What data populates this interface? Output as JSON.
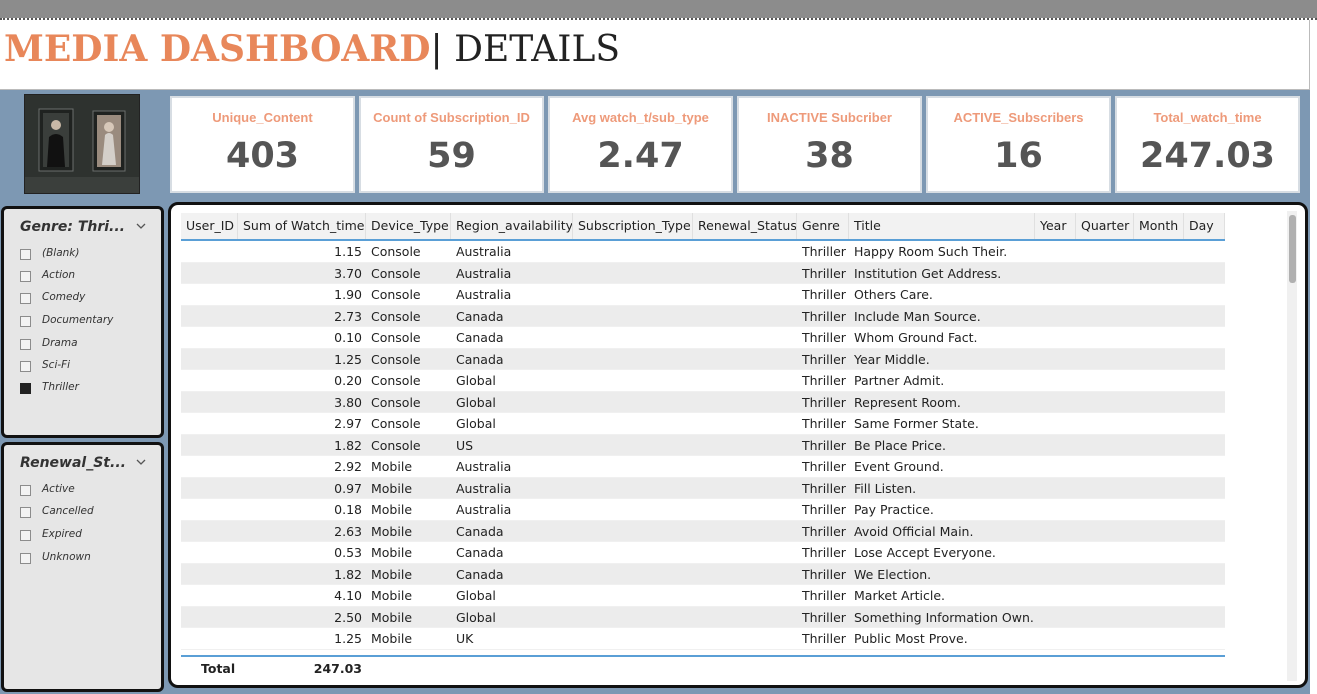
{
  "header": {
    "title_main": "MEDIA DASHBOARD",
    "separator": "|",
    "title_sub": " DETAILS"
  },
  "kpis": [
    {
      "label": "Unique_Content",
      "value": "403"
    },
    {
      "label": "Count of Subscription_ID",
      "value": "59"
    },
    {
      "label": "Avg watch_t/sub_type",
      "value": "2.47"
    },
    {
      "label": "INACTIVE Subcriber",
      "value": "38"
    },
    {
      "label": "ACTIVE_Subscribers",
      "value": "16"
    },
    {
      "label": "Total_watch_time",
      "value": "247.03"
    }
  ],
  "genre_slicer": {
    "title": "Genre: Thri...",
    "options": [
      {
        "label": "(Blank)",
        "checked": false
      },
      {
        "label": "Action",
        "checked": false
      },
      {
        "label": "Comedy",
        "checked": false
      },
      {
        "label": "Documentary",
        "checked": false
      },
      {
        "label": "Drama",
        "checked": false
      },
      {
        "label": "Sci-Fi",
        "checked": false
      },
      {
        "label": "Thriller",
        "checked": true
      }
    ]
  },
  "renewal_slicer": {
    "title": "Renewal_St...",
    "options": [
      {
        "label": "Active",
        "checked": false
      },
      {
        "label": "Cancelled",
        "checked": false
      },
      {
        "label": "Expired",
        "checked": false
      },
      {
        "label": "Unknown",
        "checked": false
      }
    ]
  },
  "table": {
    "columns": [
      "User_ID",
      "Sum of Watch_time",
      "Device_Type",
      "Region_availability",
      "Subscription_Type",
      "Renewal_Status",
      "Genre",
      "Title",
      "Year",
      "Quarter",
      "Month",
      "Day"
    ],
    "rows": [
      [
        "",
        "1.15",
        "Console",
        "Australia",
        "",
        "",
        "Thriller",
        "Happy Room Such Their.",
        "",
        "",
        "",
        ""
      ],
      [
        "",
        "3.70",
        "Console",
        "Australia",
        "",
        "",
        "Thriller",
        "Institution Get Address.",
        "",
        "",
        "",
        ""
      ],
      [
        "",
        "1.90",
        "Console",
        "Australia",
        "",
        "",
        "Thriller",
        "Others Care.",
        "",
        "",
        "",
        ""
      ],
      [
        "",
        "2.73",
        "Console",
        "Canada",
        "",
        "",
        "Thriller",
        "Include Man Source.",
        "",
        "",
        "",
        ""
      ],
      [
        "",
        "0.10",
        "Console",
        "Canada",
        "",
        "",
        "Thriller",
        "Whom Ground Fact.",
        "",
        "",
        "",
        ""
      ],
      [
        "",
        "1.25",
        "Console",
        "Canada",
        "",
        "",
        "Thriller",
        "Year Middle.",
        "",
        "",
        "",
        ""
      ],
      [
        "",
        "0.20",
        "Console",
        "Global",
        "",
        "",
        "Thriller",
        "Partner Admit.",
        "",
        "",
        "",
        ""
      ],
      [
        "",
        "3.80",
        "Console",
        "Global",
        "",
        "",
        "Thriller",
        "Represent Room.",
        "",
        "",
        "",
        ""
      ],
      [
        "",
        "2.97",
        "Console",
        "Global",
        "",
        "",
        "Thriller",
        "Same Former State.",
        "",
        "",
        "",
        ""
      ],
      [
        "",
        "1.82",
        "Console",
        "US",
        "",
        "",
        "Thriller",
        "Be Place Price.",
        "",
        "",
        "",
        ""
      ],
      [
        "",
        "2.92",
        "Mobile",
        "Australia",
        "",
        "",
        "Thriller",
        "Event Ground.",
        "",
        "",
        "",
        ""
      ],
      [
        "",
        "0.97",
        "Mobile",
        "Australia",
        "",
        "",
        "Thriller",
        "Fill Listen.",
        "",
        "",
        "",
        ""
      ],
      [
        "",
        "0.18",
        "Mobile",
        "Australia",
        "",
        "",
        "Thriller",
        "Pay Practice.",
        "",
        "",
        "",
        ""
      ],
      [
        "",
        "2.63",
        "Mobile",
        "Canada",
        "",
        "",
        "Thriller",
        "Avoid Official Main.",
        "",
        "",
        "",
        ""
      ],
      [
        "",
        "0.53",
        "Mobile",
        "Canada",
        "",
        "",
        "Thriller",
        "Lose Accept Everyone.",
        "",
        "",
        "",
        ""
      ],
      [
        "",
        "1.82",
        "Mobile",
        "Canada",
        "",
        "",
        "Thriller",
        "We Election.",
        "",
        "",
        "",
        ""
      ],
      [
        "",
        "4.10",
        "Mobile",
        "Global",
        "",
        "",
        "Thriller",
        "Market Article.",
        "",
        "",
        "",
        ""
      ],
      [
        "",
        "2.50",
        "Mobile",
        "Global",
        "",
        "",
        "Thriller",
        "Something Information Own.",
        "",
        "",
        "",
        ""
      ],
      [
        "",
        "1.25",
        "Mobile",
        "UK",
        "",
        "",
        "Thriller",
        "Public Most Prove.",
        "",
        "",
        "",
        ""
      ]
    ],
    "total_label": "Total",
    "total_value": "247.03"
  },
  "colors": {
    "accent": "#e8875a",
    "kpi_label": "#ee9a7a",
    "background": "#7d98b3",
    "header_rule": "#5a9fd6"
  },
  "icons": {
    "slicer_dropdown": "chevron-down-icon"
  }
}
